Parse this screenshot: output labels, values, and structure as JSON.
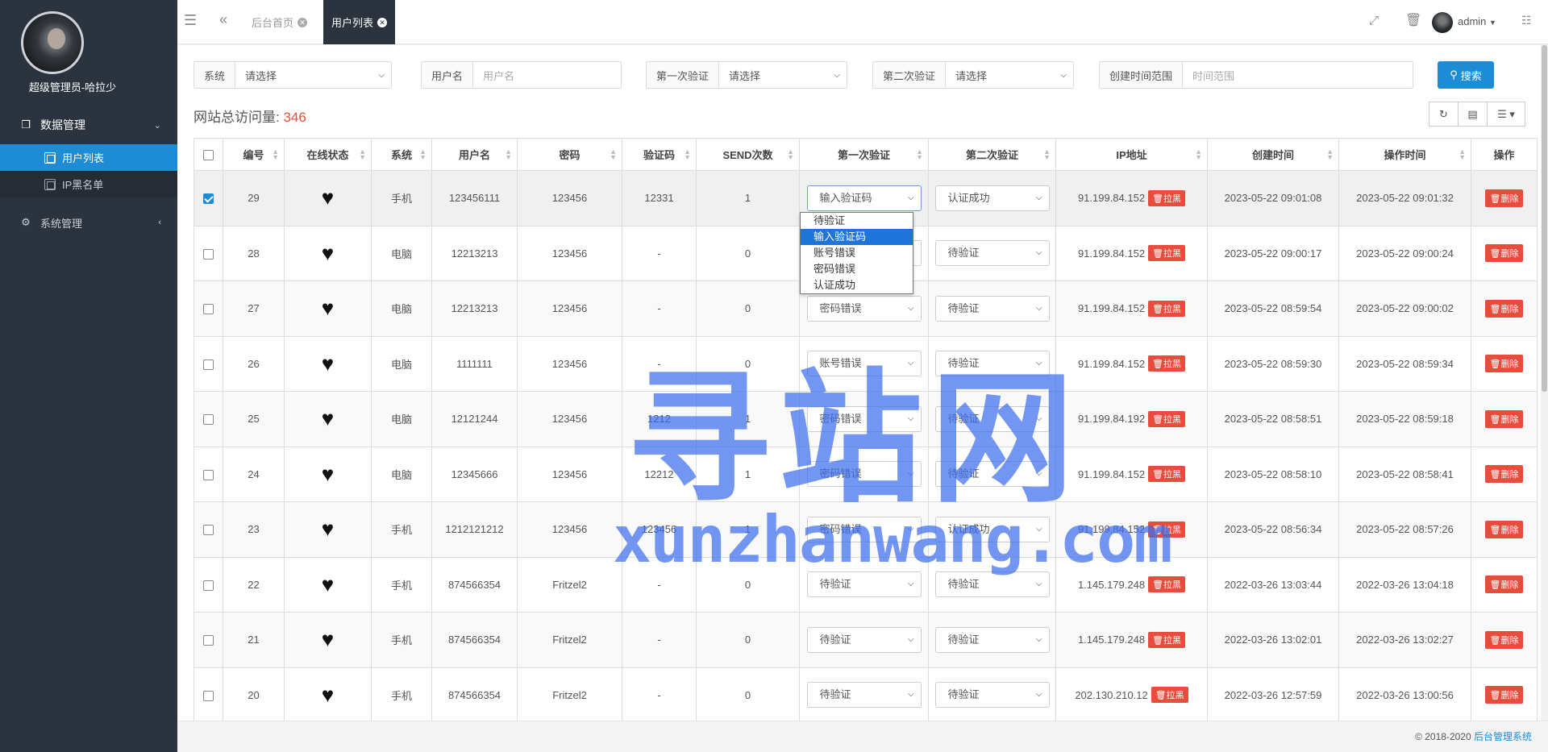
{
  "sidebar": {
    "user_name": "超级管理员-哈拉少",
    "groups": [
      {
        "label": "数据管理",
        "icon": "copy-icon",
        "items": [
          {
            "label": "用户列表",
            "active": true
          },
          {
            "label": "IP黑名单",
            "active": false
          }
        ]
      },
      {
        "label": "系统管理",
        "icon": "gears-icon",
        "items": []
      }
    ]
  },
  "topbar": {
    "tabs": [
      {
        "label": "后台首页",
        "active": false
      },
      {
        "label": "用户列表",
        "active": true
      }
    ],
    "user": "admin"
  },
  "filters": {
    "system": {
      "label": "系统",
      "value": "请选择"
    },
    "username": {
      "label": "用户名",
      "placeholder": "用户名"
    },
    "first_verify": {
      "label": "第一次验证",
      "value": "请选择"
    },
    "second_verify": {
      "label": "第二次验证",
      "value": "请选择"
    },
    "created_range": {
      "label": "创建时间范围",
      "placeholder": "时间范围"
    },
    "search_label": "搜索"
  },
  "stats": {
    "label": "网站总访问量:",
    "value": "346"
  },
  "table": {
    "columns": [
      "编号",
      "在线状态",
      "系统",
      "用户名",
      "密码",
      "验证码",
      "SEND次数",
      "第一次验证",
      "第二次验证",
      "IP地址",
      "创建时间",
      "操作时间",
      "操作"
    ],
    "blacklist_label": "拉黑",
    "delete_label": "删除",
    "rows": [
      {
        "id": "29",
        "status": "♥",
        "system": "手机",
        "username": "123456111",
        "password": "123456",
        "code": "12331",
        "send": "1",
        "first": "输入验证码",
        "second": "认证成功",
        "ip": "91.199.84.152",
        "created": "2023-05-22 09:01:08",
        "updated": "2023-05-22 09:01:32",
        "checked": true
      },
      {
        "id": "28",
        "status": "♥",
        "system": "电脑",
        "username": "12213213",
        "password": "123456",
        "code": "-",
        "send": "0",
        "first": "待验证",
        "second": "待验证",
        "ip": "91.199.84.152",
        "created": "2023-05-22 09:00:17",
        "updated": "2023-05-22 09:00:24",
        "checked": false
      },
      {
        "id": "27",
        "status": "♥",
        "system": "电脑",
        "username": "12213213",
        "password": "123456",
        "code": "-",
        "send": "0",
        "first": "密码错误",
        "second": "待验证",
        "ip": "91.199.84.152",
        "created": "2023-05-22 08:59:54",
        "updated": "2023-05-22 09:00:02",
        "checked": false
      },
      {
        "id": "26",
        "status": "♥",
        "system": "电脑",
        "username": "1111111",
        "password": "123456",
        "code": "-",
        "send": "0",
        "first": "账号错误",
        "second": "待验证",
        "ip": "91.199.84.152",
        "created": "2023-05-22 08:59:30",
        "updated": "2023-05-22 08:59:34",
        "checked": false
      },
      {
        "id": "25",
        "status": "♥",
        "system": "电脑",
        "username": "12121244",
        "password": "123456",
        "code": "1212",
        "send": "1",
        "first": "密码错误",
        "second": "待验证",
        "ip": "91.199.84.192",
        "created": "2023-05-22 08:58:51",
        "updated": "2023-05-22 08:59:18",
        "checked": false
      },
      {
        "id": "24",
        "status": "♥",
        "system": "电脑",
        "username": "12345666",
        "password": "123456",
        "code": "12212",
        "send": "1",
        "first": "密码错误",
        "second": "待验证",
        "ip": "91.199.84.152",
        "created": "2023-05-22 08:58:10",
        "updated": "2023-05-22 08:58:41",
        "checked": false
      },
      {
        "id": "23",
        "status": "♥",
        "system": "手机",
        "username": "1212121212",
        "password": "123456",
        "code": "123456",
        "send": "1",
        "first": "密码错误",
        "second": "认证成功",
        "ip": "91.199.84.152",
        "created": "2023-05-22 08:56:34",
        "updated": "2023-05-22 08:57:26",
        "checked": false
      },
      {
        "id": "22",
        "status": "♥",
        "system": "手机",
        "username": "874566354",
        "password": "Fritzel2",
        "code": "-",
        "send": "0",
        "first": "待验证",
        "second": "待验证",
        "ip": "1.145.179.248",
        "created": "2022-03-26 13:03:44",
        "updated": "2022-03-26 13:04:18",
        "checked": false
      },
      {
        "id": "21",
        "status": "♥",
        "system": "手机",
        "username": "874566354",
        "password": "Fritzel2",
        "code": "-",
        "send": "0",
        "first": "待验证",
        "second": "待验证",
        "ip": "1.145.179.248",
        "created": "2022-03-26 13:02:01",
        "updated": "2022-03-26 13:02:27",
        "checked": false
      },
      {
        "id": "20",
        "status": "♥",
        "system": "手机",
        "username": "874566354",
        "password": "Fritzel2",
        "code": "-",
        "send": "0",
        "first": "待验证",
        "second": "待验证",
        "ip": "202.130.210.12",
        "created": "2022-03-26 12:57:59",
        "updated": "2022-03-26 13:00:56",
        "checked": false
      }
    ]
  },
  "dropdown_open": {
    "options": [
      "待验证",
      "输入验证码",
      "账号错误",
      "密码错误",
      "认证成功"
    ],
    "highlighted": "输入验证码"
  },
  "footer": {
    "copyright": "© 2018-2020",
    "link": "后台管理系统"
  },
  "watermark": {
    "cn": "寻站网",
    "en": "xunzhanwang.com"
  },
  "colors": {
    "primary": "#1e8bd5",
    "sidebar": "#2b333e",
    "danger": "#e74c3c",
    "watermark": "#3c6eeb"
  }
}
